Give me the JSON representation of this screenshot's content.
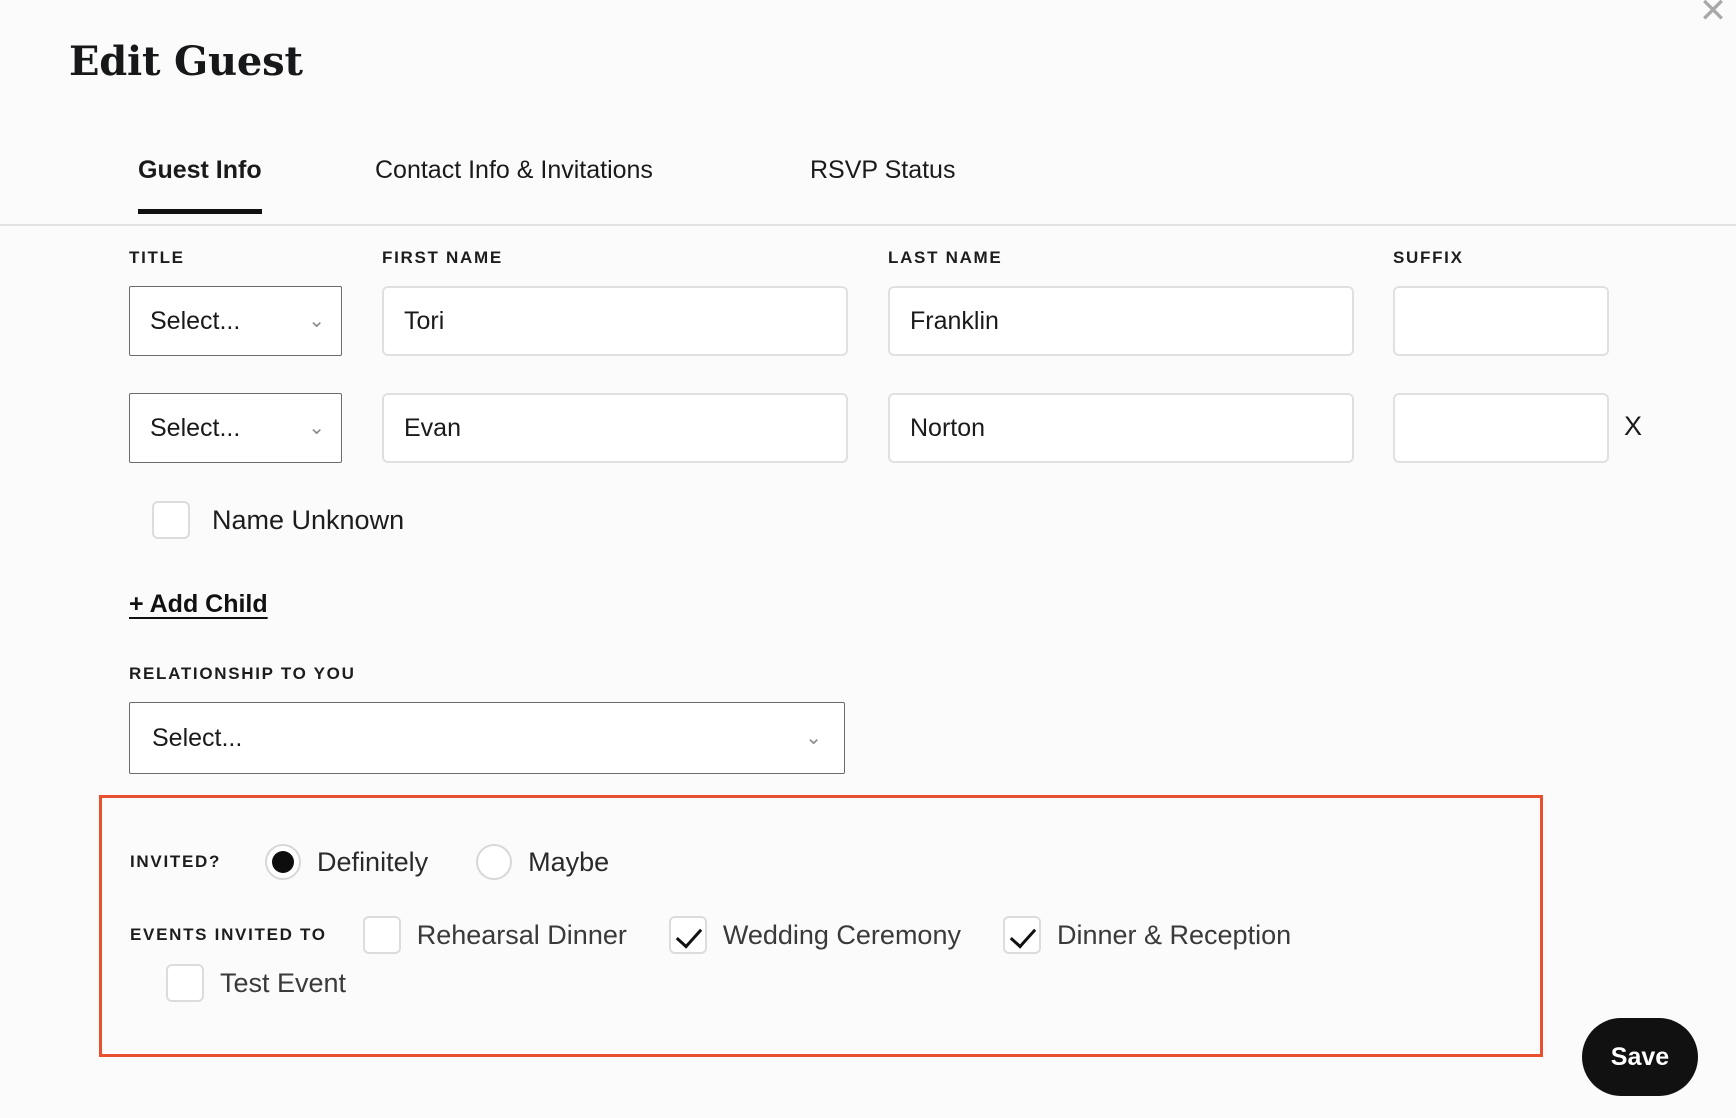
{
  "modal": {
    "title": "Edit Guest",
    "close_icon": "close-icon"
  },
  "tabs": [
    {
      "label": "Guest Info",
      "active": true
    },
    {
      "label": "Contact Info & Invitations",
      "active": false
    },
    {
      "label": "RSVP Status",
      "active": false
    }
  ],
  "labels": {
    "title": "TITLE",
    "first_name": "FIRST NAME",
    "last_name": "LAST NAME",
    "suffix": "SUFFIX",
    "relationship": "RELATIONSHIP TO YOU",
    "invited": "INVITED?",
    "events_invited_to": "EVENTS INVITED TO"
  },
  "guests": [
    {
      "title_value": "Select...",
      "first_name": "Tori",
      "last_name": "Franklin",
      "suffix": "",
      "removable": false
    },
    {
      "title_value": "Select...",
      "first_name": "Evan",
      "last_name": "Norton",
      "suffix": "",
      "removable": true,
      "remove_label": "X"
    }
  ],
  "name_unknown": {
    "label": "Name Unknown",
    "checked": false
  },
  "add_child": {
    "label": "+ Add Child"
  },
  "relationship": {
    "value": "Select...",
    "placeholder": "Select..."
  },
  "invited": {
    "options": [
      {
        "label": "Definitely",
        "selected": true
      },
      {
        "label": "Maybe",
        "selected": false
      }
    ]
  },
  "events": [
    {
      "label": "Rehearsal Dinner",
      "checked": false
    },
    {
      "label": "Wedding Ceremony",
      "checked": true
    },
    {
      "label": "Dinner & Reception",
      "checked": true
    },
    {
      "label": "Test Event",
      "checked": false
    }
  ],
  "actions": {
    "save": "Save"
  },
  "icons": {
    "chevron_down": "⌄",
    "close": "✕"
  },
  "colors": {
    "accent_highlight": "#e8502e",
    "primary": "#111111",
    "page_bg": "#fbfbfb"
  }
}
